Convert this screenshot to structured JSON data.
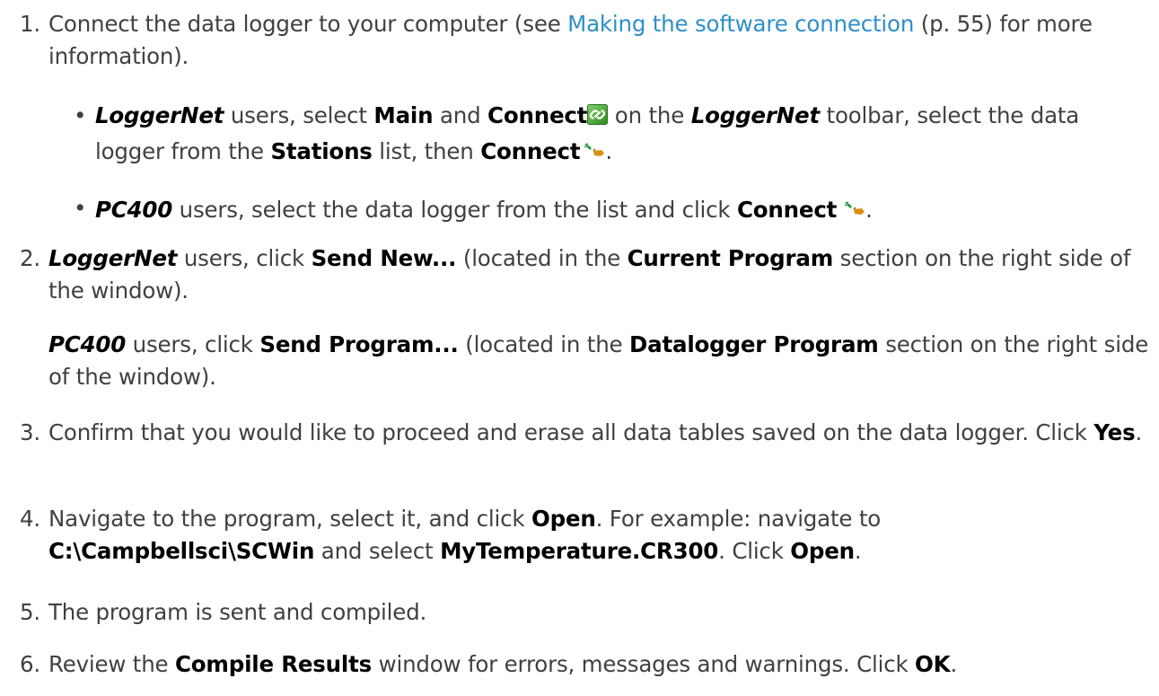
{
  "steps": [
    {
      "number": "1.",
      "pre": "Connect the data logger to your computer (see ",
      "link": "Making the software connection",
      "post": " (p. 55) for more information)."
    },
    {
      "number": "2.",
      "app": "LoggerNet",
      "t1": " users, click ",
      "b1": "Send New...",
      "t2": " (located in the ",
      "b2": "Current Program",
      "t3": " section on the right side of the window).",
      "app2": "PC400",
      "t4": " users, click ",
      "b3": "Send Program...",
      "t5": " (located in the ",
      "b4": "Datalogger Program",
      "t6": " section on the right side of the window)."
    },
    {
      "number": "3.",
      "t1": "Confirm that you would like to proceed and erase all data tables saved on the data logger. Click ",
      "b1": "Yes",
      "t2": "."
    },
    {
      "number": "4.",
      "t1": "Navigate to the program, select it, and click ",
      "b1": "Open",
      "t2": ". For example: navigate to ",
      "b2": "C:\\Campbellsci\\SCWin",
      "t3": " and select ",
      "b3": "MyTemperature.CR300",
      "t4": ". Click ",
      "b4": "Open",
      "t5": "."
    },
    {
      "number": "5.",
      "t1": "The program is sent and compiled."
    },
    {
      "number": "6.",
      "t1": "Review the ",
      "b1": "Compile Results",
      "t2": " window for errors, messages and warnings. Click ",
      "b2": "OK",
      "t3": "."
    }
  ],
  "bullets": [
    {
      "dot": "•",
      "app": "LoggerNet",
      "t1": " users, select ",
      "b1": "Main",
      "t2": " and ",
      "b2": "Connect",
      "t3": " on the ",
      "app2": "LoggerNet",
      "t4": " toolbar, select the data logger from the ",
      "b3": "Stations",
      "t5": " list, then ",
      "b4": "Connect",
      "t6": "."
    },
    {
      "dot": "•",
      "app": "PC400",
      "t1": " users, select the data logger from the list and click ",
      "b1": "Connect",
      "t2": "."
    }
  ],
  "icons": {
    "connect_toolbar": "connect-chain-icon",
    "connect_plug": "plug-connect-icon",
    "toolbar_green": "#3c9a28",
    "plug_green": "#1e9b3e",
    "plug_orange": "#d99011",
    "link_color": "#2e8fc9"
  }
}
